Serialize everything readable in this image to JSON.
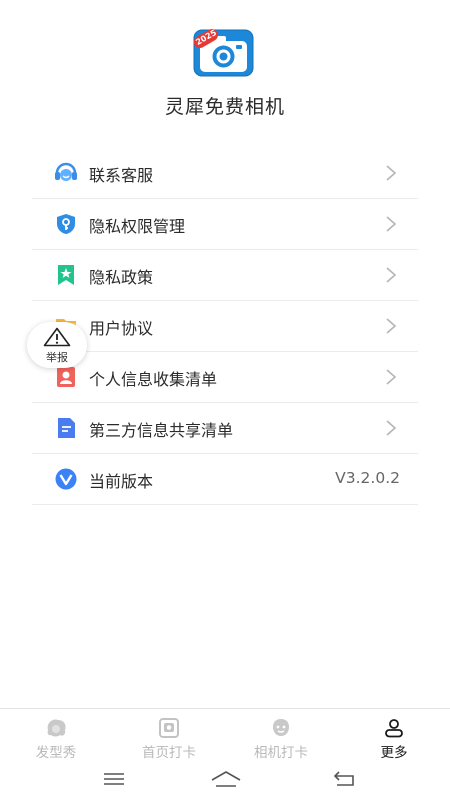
{
  "app": {
    "name": "灵犀免费相机",
    "logo_badge": "2025"
  },
  "menu": {
    "items": [
      {
        "label": "联系客服",
        "icon": "headset-icon",
        "color": "#3a8ee6"
      },
      {
        "label": "隐私权限管理",
        "icon": "shield-key-icon",
        "color": "#2f8de4"
      },
      {
        "label": "隐私政策",
        "icon": "bookmark-star-icon",
        "color": "#21c48b"
      },
      {
        "label": "用户协议",
        "icon": "folder-icon",
        "color": "#f6b93b"
      },
      {
        "label": "个人信息收集清单",
        "icon": "person-card-icon",
        "color": "#f0635c"
      },
      {
        "label": "第三方信息共享清单",
        "icon": "document-icon",
        "color": "#4a7cf0"
      },
      {
        "label": "当前版本",
        "icon": "version-v-icon",
        "color": "#3b82f6",
        "value": "V3.2.0.2"
      }
    ]
  },
  "report": {
    "label": "举报",
    "icon": "warning-triangle-icon"
  },
  "tabbar": {
    "tabs": [
      {
        "label": "发型秀",
        "icon": "hairstyle-icon",
        "active": false
      },
      {
        "label": "首页打卡",
        "icon": "camera-frame-icon",
        "active": false
      },
      {
        "label": "相机打卡",
        "icon": "face-icon",
        "active": false
      },
      {
        "label": "更多",
        "icon": "person-icon",
        "active": true
      }
    ]
  },
  "system_nav": {
    "buttons": [
      "menu-icon",
      "home-icon",
      "back-icon"
    ]
  }
}
